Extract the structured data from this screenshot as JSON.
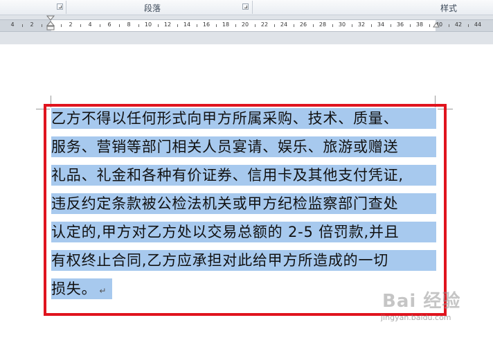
{
  "ribbon": {
    "groups": [
      {
        "label": ""
      },
      {
        "label": "段落"
      },
      {
        "label": "样式"
      }
    ]
  },
  "ruler": {
    "labels": [
      "4",
      "2",
      "2",
      "4",
      "6",
      "8",
      "10",
      "12",
      "14",
      "16",
      "18",
      "20",
      "22",
      "24",
      "26",
      "28",
      "30",
      "32",
      "34",
      "36",
      "38",
      "40",
      "42",
      "44"
    ]
  },
  "document": {
    "lines": [
      "乙方不得以任何形式向甲方所属采购、技术、质量、",
      "服务、营销等部门相关人员宴请、娱乐、旅游或赠送",
      "礼品、礼金和各种有价证券、信用卡及其他支付凭证,",
      "违反约定条款被公检法机关或甲方纪检监察部门查处",
      "认定的,甲方对乙方处以交易总额的 2-5 倍罚款,并且",
      "有权终止合同,乙方应承担对此给甲方所造成的一切",
      "损失。"
    ],
    "paragraph_mark": "↵",
    "selection_color": "#a7c9ee",
    "highlight_box_color": "#e0141e"
  },
  "watermark": {
    "logo_text": "Bai 经验",
    "url": "jingyan.baidu.com"
  }
}
